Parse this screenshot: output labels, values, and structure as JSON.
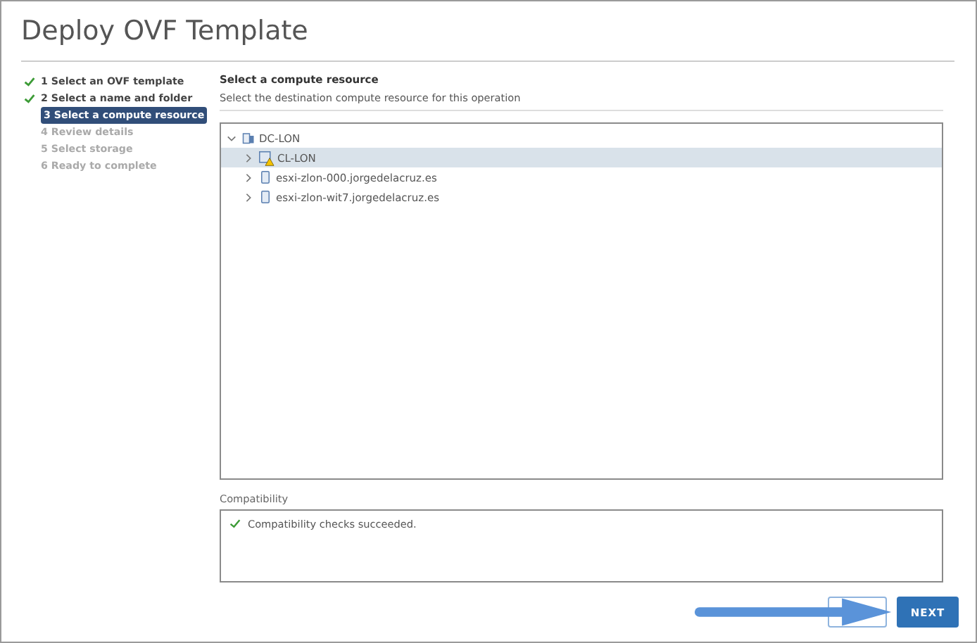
{
  "window": {
    "title": "Deploy OVF Template"
  },
  "steps": [
    {
      "label": "1 Select an OVF template",
      "completed": true,
      "selected": false
    },
    {
      "label": "2 Select a name and folder",
      "completed": true,
      "selected": false
    },
    {
      "label": "3 Select a compute resource",
      "completed": false,
      "selected": true
    },
    {
      "label": "4 Review details",
      "completed": false,
      "selected": false
    },
    {
      "label": "5 Select storage",
      "completed": false,
      "selected": false
    },
    {
      "label": "6 Ready to complete",
      "completed": false,
      "selected": false
    }
  ],
  "content": {
    "heading": "Select a compute resource",
    "description": "Select the destination compute resource for this operation"
  },
  "tree": [
    {
      "label": "DC-LON",
      "kind": "datacenter",
      "expanded": true,
      "selected": false,
      "children": [
        {
          "label": "CL-LON",
          "kind": "cluster",
          "warning": true,
          "expanded": false,
          "selected": true
        },
        {
          "label": "esxi-zlon-000.jorgedelacruz.es",
          "kind": "host",
          "warning": false,
          "expanded": false,
          "selected": false
        },
        {
          "label": "esxi-zlon-wit7.jorgedelacruz.es",
          "kind": "host",
          "warning": false,
          "expanded": false,
          "selected": false
        }
      ]
    }
  ],
  "compatibility": {
    "label": "Compatibility",
    "message": "Compatibility checks succeeded.",
    "succeeded": true
  },
  "buttons": {
    "next": "NEXT"
  }
}
